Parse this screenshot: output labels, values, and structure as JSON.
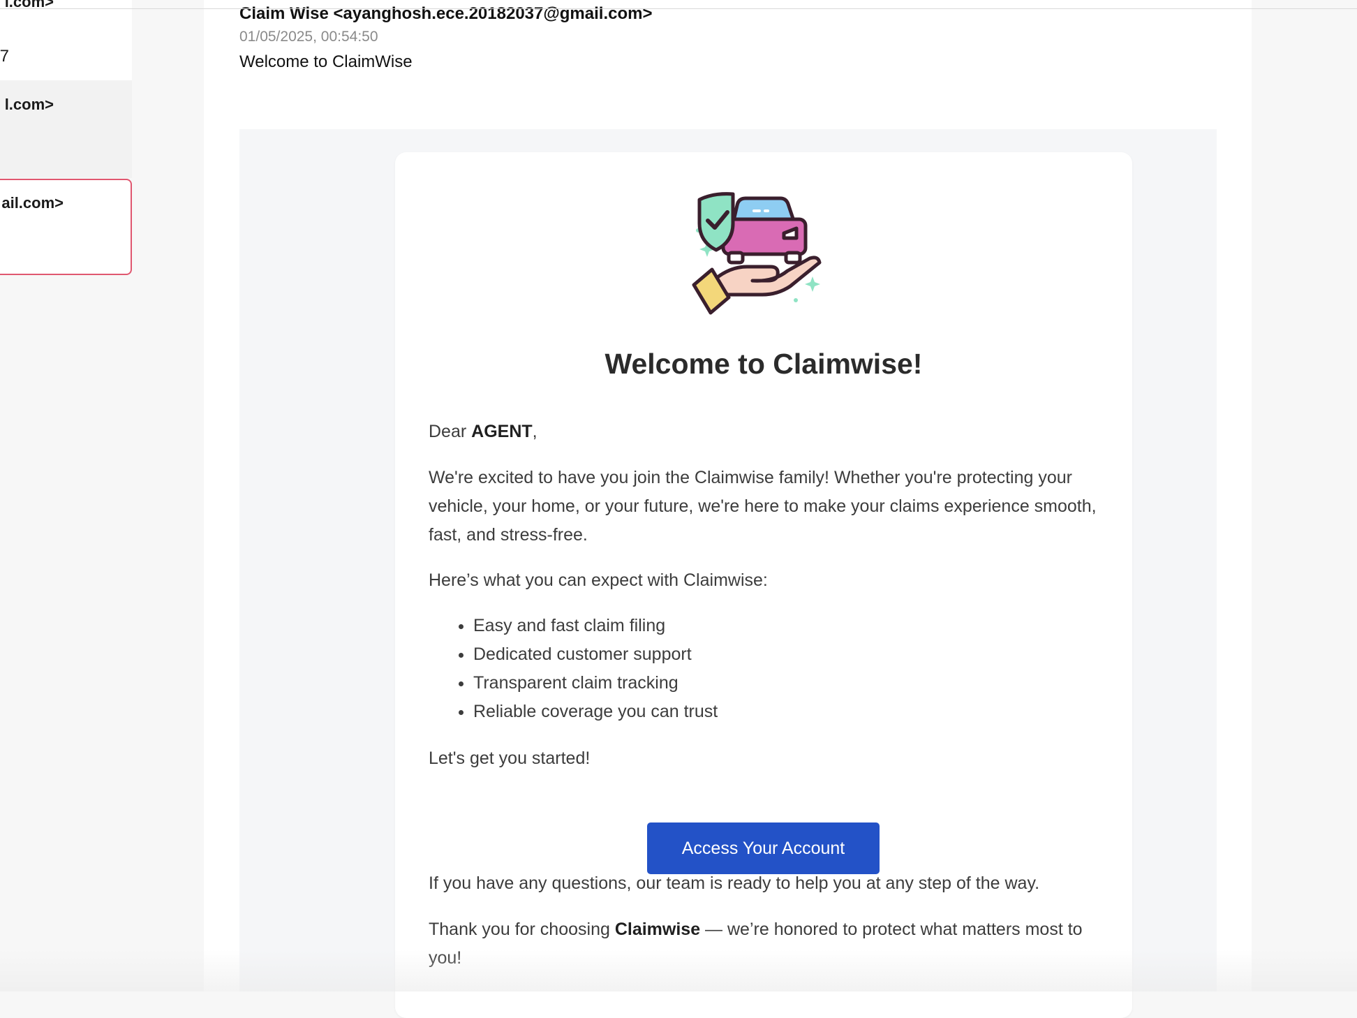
{
  "mail_list": {
    "items": [
      {
        "sender_fragment": "l.com>",
        "sub_fragment": "7"
      },
      {
        "sender_fragment": "l.com>"
      },
      {
        "sender_fragment": "ail.com>"
      }
    ]
  },
  "email": {
    "from": "Claim Wise <ayanghosh.ece.20182037@gmail.com>",
    "date": "01/05/2025, 00:54:50",
    "subject": "Welcome to ClaimWise",
    "body": {
      "title": "Welcome to Claimwise!",
      "greeting_prefix": "Dear ",
      "greeting_name": "AGENT",
      "greeting_suffix": ",",
      "intro": "We're excited to have you join the Claimwise family! Whether you're protecting your vehicle, your home, or your future, we're here to make your claims experience smooth, fast, and stress-free.",
      "expect": "Here’s what you can expect with Claimwise:",
      "features": [
        "Easy and fast claim filing",
        "Dedicated customer support",
        "Transparent claim tracking",
        "Reliable coverage you can trust"
      ],
      "started": "Let's get you started!",
      "cta_label": "Access Your Account",
      "questions": "If you have any questions, our team is ready to help you at any step of the way.",
      "thanks_prefix": "Thank you for choosing ",
      "thanks_brand": "Claimwise",
      "thanks_suffix": " — we’re honored to protect what matters most to you!"
    }
  },
  "colors": {
    "accent_button": "#2352c7",
    "selected_border": "#e0576f",
    "hero_shield": "#8fe3c4",
    "hero_car": "#d96bb4",
    "hero_window": "#8ecdf2",
    "hero_hand": "#f7d3c4",
    "hero_cuff": "#f3d77a"
  },
  "icons": {
    "hero": "car-insurance-hand-icon"
  }
}
